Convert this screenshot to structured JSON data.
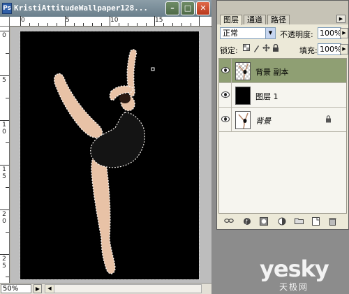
{
  "window": {
    "title": "KristiAttitudeWallpaper128...",
    "app_icon": "Ps",
    "minimize": "–",
    "maximize": "□",
    "close": "✕"
  },
  "rulers": {
    "horizontal_labels": [
      "0",
      "5",
      "10",
      "15"
    ],
    "vertical_labels": [
      "0",
      "5",
      "1 0",
      "1 5",
      "2 0",
      "2 5"
    ]
  },
  "status": {
    "zoom": "50%",
    "nav_arrow": "▶",
    "scroll_left": "◀"
  },
  "panel": {
    "tabs": [
      "图层",
      "通道",
      "路径"
    ],
    "menu_arrow": "▶",
    "blend_mode": "正常",
    "dropdown_arrow": "▼",
    "opacity_label": "不透明度:",
    "opacity_value": "100%",
    "lock_label": "锁定:",
    "fill_label": "填充:",
    "fill_value": "100%",
    "spin_arrow": "▶",
    "layers": [
      {
        "name": "背景 副本",
        "selected": true,
        "thumbnail": "dancer-transparent"
      },
      {
        "name": "图层 1",
        "selected": false,
        "thumbnail": "black-fill"
      },
      {
        "name": "背景",
        "selected": false,
        "thumbnail": "dancer-on-white",
        "locked": true
      }
    ],
    "lock_badge_icon": "padlock-icon",
    "footer_icons": [
      "link-icon",
      "layer-style-icon",
      "mask-icon",
      "adjustment-icon",
      "new-group-icon",
      "new-layer-icon",
      "trash-icon"
    ]
  },
  "watermark": {
    "main": "yesky",
    "sub": "天极网"
  }
}
